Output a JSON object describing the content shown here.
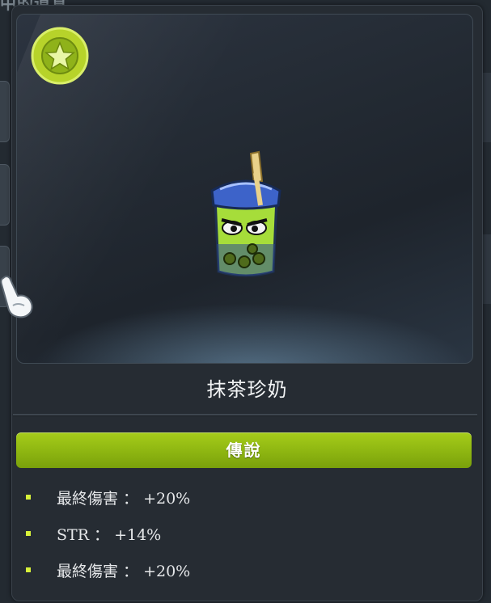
{
  "background": {
    "title_fragment": "中的道具"
  },
  "item": {
    "name": "抹茶珍奶",
    "grade": "傳說",
    "grade_color": "#8db511",
    "badge_icon": "star-badge-icon",
    "art_icon": "matcha-bubble-tea-icon"
  },
  "stats": [
    {
      "text": "最終傷害 ： +20%"
    },
    {
      "text": "STR ： +14%"
    },
    {
      "text": "最終傷害 ： +20%"
    }
  ],
  "colors": {
    "bullet": "#d8f23a",
    "panel_bg": "#262c33",
    "text": "#e6e8ea"
  }
}
